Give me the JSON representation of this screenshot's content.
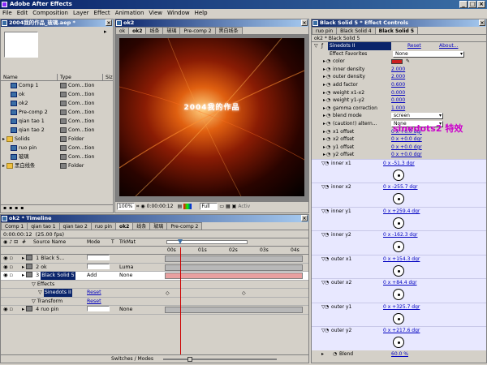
{
  "window": {
    "title": "Adobe After Effects"
  },
  "menu": [
    "File",
    "Edit",
    "Composition",
    "Layer",
    "Effect",
    "Animation",
    "View",
    "Window",
    "Help"
  ],
  "project": {
    "title": "2004我的作品_玻璃.aep *",
    "columns": {
      "name": "Name",
      "type": "Type",
      "size": "Siz"
    },
    "items": [
      {
        "name": "Comp 1",
        "type": "Com...tion",
        "kind": "comp"
      },
      {
        "name": "ok",
        "type": "Com...tion",
        "kind": "comp"
      },
      {
        "name": "ok2",
        "type": "Com...tion",
        "kind": "comp"
      },
      {
        "name": "Pre-comp 2",
        "type": "Com...tion",
        "kind": "comp"
      },
      {
        "name": "qian tao 1",
        "type": "Com...tion",
        "kind": "comp"
      },
      {
        "name": "qian tao 2",
        "type": "Com...tion",
        "kind": "comp"
      },
      {
        "name": "Solids",
        "type": "Folder",
        "kind": "folder"
      },
      {
        "name": "ruo pin",
        "type": "Com...tion",
        "kind": "comp"
      },
      {
        "name": "玻璃",
        "type": "Com...tion",
        "kind": "comp"
      },
      {
        "name": "黑白线条",
        "type": "Folder",
        "kind": "folder"
      }
    ]
  },
  "comp": {
    "title": "ok2",
    "tabs": [
      "ok",
      "ok2",
      "线条",
      "玻璃",
      "Pre-comp 2",
      "黑白线条"
    ],
    "active_tab": 1,
    "frame_text": "2004我的作品",
    "zoom": "100%",
    "time": "0:00:00:12",
    "res": "Full",
    "active_label": "Activ"
  },
  "timeline": {
    "title": "ok2 * Timeline",
    "tabs": [
      "Comp 1",
      "qian tao 1",
      "qian tao 2",
      "ruo pin",
      "ok2",
      "线条",
      "玻璃",
      "Pre-comp 2"
    ],
    "active_tab": 4,
    "time": "0:00:00:12",
    "fps": "(25.00 fps)",
    "columns": {
      "num": "#",
      "source": "Source Name",
      "mode": "Mode",
      "t": "T",
      "trkmat": "TrkMat"
    },
    "ruler": [
      "00s",
      "01s",
      "02s",
      "03s",
      "04s"
    ],
    "layers": [
      {
        "num": "1",
        "name": "Black S...",
        "mode": "",
        "trk": "",
        "sel": false
      },
      {
        "num": "2",
        "name": "ok",
        "mode": "",
        "trk": "Luma",
        "sel": false
      },
      {
        "num": "3",
        "name": "Black Solid 5",
        "mode": "Add",
        "trk": "None",
        "sel": true
      },
      {
        "num": "",
        "name": "Effects",
        "mode": "",
        "trk": "",
        "sel": false
      },
      {
        "num": "",
        "name": "Sinedots II",
        "mode": "Reset",
        "trk": "",
        "sel": false
      },
      {
        "num": "",
        "name": "Transform",
        "mode": "Reset",
        "trk": "",
        "sel": false
      },
      {
        "num": "4",
        "name": "ruo pin",
        "mode": "",
        "trk": "None",
        "sel": false
      }
    ],
    "bottom_label": "Switches / Modes"
  },
  "effects": {
    "title": "Black Solid 5 * Effect Controls",
    "tabs": [
      "ruo pin",
      "Black Solid 4",
      "Black Solid 5"
    ],
    "active_tab": 2,
    "breadcrumb": "ok2 * Black Solid 5",
    "effect_name": "Sinedots II",
    "reset": "Reset",
    "about": "About...",
    "favorites_label": "Effect Favorites",
    "favorites_value": "None",
    "annotation": "sinedots2 特效",
    "params": [
      {
        "label": "color",
        "value": "",
        "type": "color"
      },
      {
        "label": "inner density",
        "value": "2.000",
        "type": "num"
      },
      {
        "label": "outer density",
        "value": "2.000",
        "type": "num"
      },
      {
        "label": "add factor",
        "value": "0.600",
        "type": "num"
      },
      {
        "label": "weight x1-x2",
        "value": "0.000",
        "type": "num"
      },
      {
        "label": "weight y1-y2",
        "value": "0.000",
        "type": "num"
      },
      {
        "label": "gamma correction",
        "value": "1.000",
        "type": "num"
      },
      {
        "label": "blend mode",
        "value": "screen",
        "type": "select"
      },
      {
        "label": "(caution!) altern...",
        "value": "None",
        "type": "select"
      },
      {
        "label": "x1 offset",
        "value": "0 x +0.0 dgr",
        "type": "num"
      },
      {
        "label": "x2 offset",
        "value": "0 x +0.0 dgr",
        "type": "num"
      },
      {
        "label": "y1 offset",
        "value": "0 x +0.0 dgr",
        "type": "num"
      },
      {
        "label": "y2 offset",
        "value": "0 x +0.0 dgr",
        "type": "num"
      }
    ],
    "dial_params": [
      {
        "label": "inner x1",
        "value": "0 x -51.3 dgr"
      },
      {
        "label": "inner x2",
        "value": "0 x -255.7 dgr"
      },
      {
        "label": "inner y1",
        "value": "0 x +259.4 dgr"
      },
      {
        "label": "inner y2",
        "value": "0 x -162.3 dgr"
      },
      {
        "label": "outer x1",
        "value": "0 x +154.3 dgr"
      },
      {
        "label": "outer x2",
        "value": "0 x +84.4 dgr"
      },
      {
        "label": "outer y1",
        "value": "0 x +325.7 dgr"
      },
      {
        "label": "outer y2",
        "value": "0 x +217.6 dgr"
      }
    ],
    "blend_label": "Blend",
    "blend_value": "60.0 %"
  },
  "colors": {
    "accent": "#0a246a",
    "selected_layer": "#0a246a",
    "effect_highlight": "#e8e8ff",
    "time_marker": "#cc0000",
    "annotation": "#cc00cc"
  }
}
